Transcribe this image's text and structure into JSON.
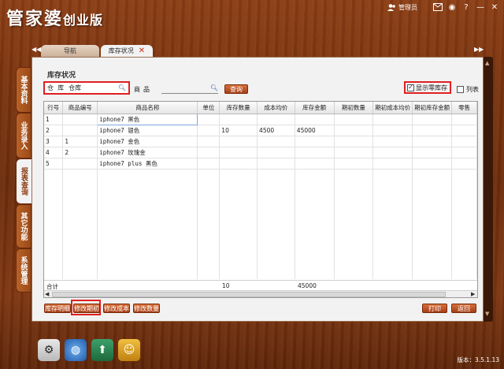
{
  "app": {
    "logo_main": "管家婆",
    "logo_edition": "创业版",
    "user_label": "管理员",
    "version_text": "版本：3.5.1.13"
  },
  "tabs": [
    {
      "label": "导航"
    },
    {
      "label": "库存状况"
    }
  ],
  "sidebar": {
    "items": [
      {
        "label": "基本资料"
      },
      {
        "label": "业务录入"
      },
      {
        "label": "报表查询"
      },
      {
        "label": "其它功能"
      },
      {
        "label": "系统管理"
      }
    ]
  },
  "page": {
    "title": "库存状况"
  },
  "filter": {
    "warehouse_label": "仓  库",
    "warehouse_value": "仓库",
    "product_label": "商品",
    "product_value": "",
    "query_button": "查询",
    "show_zero_label": "显示零库存",
    "show_zero_checked": true,
    "column_label": "列表"
  },
  "table": {
    "columns": [
      "行号",
      "商品编号",
      "商品名称",
      "单位",
      "库存数量",
      "成本均价",
      "库存金额",
      "期初数量",
      "期初成本均价",
      "期初库存金额",
      "零售"
    ],
    "rows": [
      [
        "1",
        "",
        "iphone7 黑色",
        "",
        "",
        "",
        "",
        "",
        "",
        "",
        ""
      ],
      [
        "2",
        "",
        "iphone7 银色",
        "",
        "10",
        "4500",
        "45000",
        "",
        "",
        "",
        ""
      ],
      [
        "3",
        "1",
        "iphone7 金色",
        "",
        "",
        "",
        "",
        "",
        "",
        "",
        ""
      ],
      [
        "4",
        "2",
        "iphone7 玫瑰金",
        "",
        "",
        "",
        "",
        "",
        "",
        "",
        ""
      ],
      [
        "5",
        "",
        "iphone7 plus 黑色",
        "",
        "",
        "",
        "",
        "",
        "",
        "",
        ""
      ]
    ],
    "total_label": "合计",
    "total_qty": "10",
    "total_amount": "45000"
  },
  "buttons": {
    "stock_detail": "库存明细",
    "edit_opening": "修改期初",
    "edit_cost": "修改成本",
    "edit_qty": "修改数量",
    "print": "打印",
    "back": "返回"
  },
  "colors": {
    "highlight_border": "#e02020",
    "button_bg": "#c25a28",
    "wood_bg": "#7a3410"
  }
}
